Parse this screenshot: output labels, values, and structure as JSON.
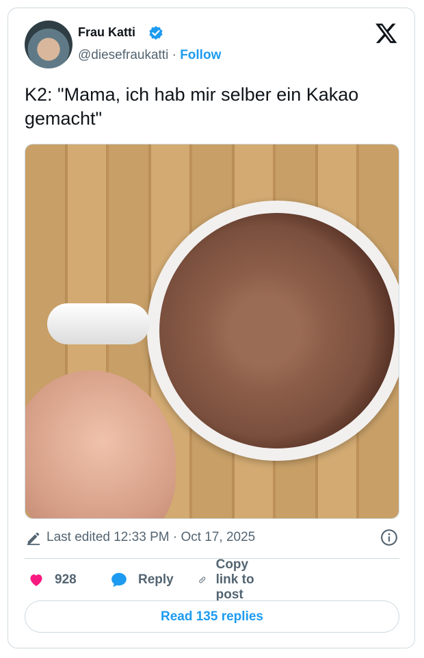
{
  "author": {
    "name": "Frau Katti",
    "handle": "@diesefraukatti",
    "separator": "·",
    "follow_label": "Follow",
    "verified_icon": "verified-badge-icon"
  },
  "platform_logo": "x-logo-icon",
  "tweet": {
    "text": "K2: \"Mama, ich hab mir selber ein Kakao gemacht\""
  },
  "meta": {
    "edited_text": "Last edited 12:33 PM · Oct 17, 2025",
    "edit_icon": "pencil-icon",
    "info_icon": "info-icon"
  },
  "actions": {
    "likes": "928",
    "like_icon": "heart-icon",
    "reply_label": "Reply",
    "reply_icon": "speech-bubble-icon",
    "copy_label": "Copy link to post",
    "copy_icon": "link-icon"
  },
  "read_replies_label": "Read 135 replies",
  "colors": {
    "accent": "#1d9bf0",
    "like": "#f91880",
    "text": "#0f1419",
    "secondary": "#536471",
    "border": "#cfd9de"
  }
}
